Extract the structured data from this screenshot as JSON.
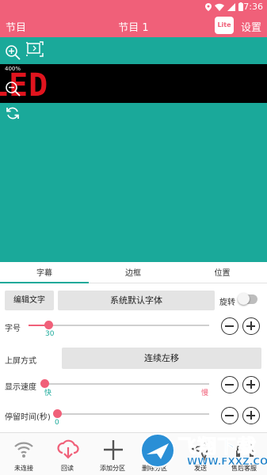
{
  "status_bar": {
    "time": "7:36",
    "colors": {
      "bar": "#f06079"
    }
  },
  "toolbar": {
    "left_label": "节目",
    "title": "节目 1",
    "lite_badge": "Lite",
    "settings_label": "设置"
  },
  "preview": {
    "zoom_label": "400%",
    "led_text": "LED",
    "background": "#1aa99a"
  },
  "tabs": [
    {
      "label": "字幕",
      "active": true
    },
    {
      "label": "边框",
      "active": false
    },
    {
      "label": "位置",
      "active": false
    }
  ],
  "editor": {
    "edit_text_button": "编辑文字",
    "font_button": "系统默认字体",
    "rotate_label": "旋转",
    "rotate_on": false,
    "font_size": {
      "label": "字号",
      "value": "30",
      "fraction": 0.11
    },
    "screen_mode": {
      "label": "上屏方式",
      "value": "连续左移"
    },
    "speed": {
      "label": "显示速度",
      "min_label": "快",
      "max_label": "慢",
      "fraction": 0.0
    },
    "stay": {
      "label": "停留时间(秒)",
      "value": "0",
      "fraction": 0.0
    }
  },
  "bottom_nav": [
    {
      "label": "未连接",
      "icon": "wifi-icon"
    },
    {
      "label": "回读",
      "icon": "cloud-download-icon"
    },
    {
      "label": "添加分区",
      "icon": "plus-icon"
    },
    {
      "label": "删除分区",
      "icon": "delete-icon"
    },
    {
      "label": "发送",
      "icon": "send-icon"
    },
    {
      "label": "售后客服",
      "icon": "service-icon"
    }
  ],
  "watermark": {
    "text": "飞翔下载",
    "url": "WWW.FXXZ.COM"
  }
}
